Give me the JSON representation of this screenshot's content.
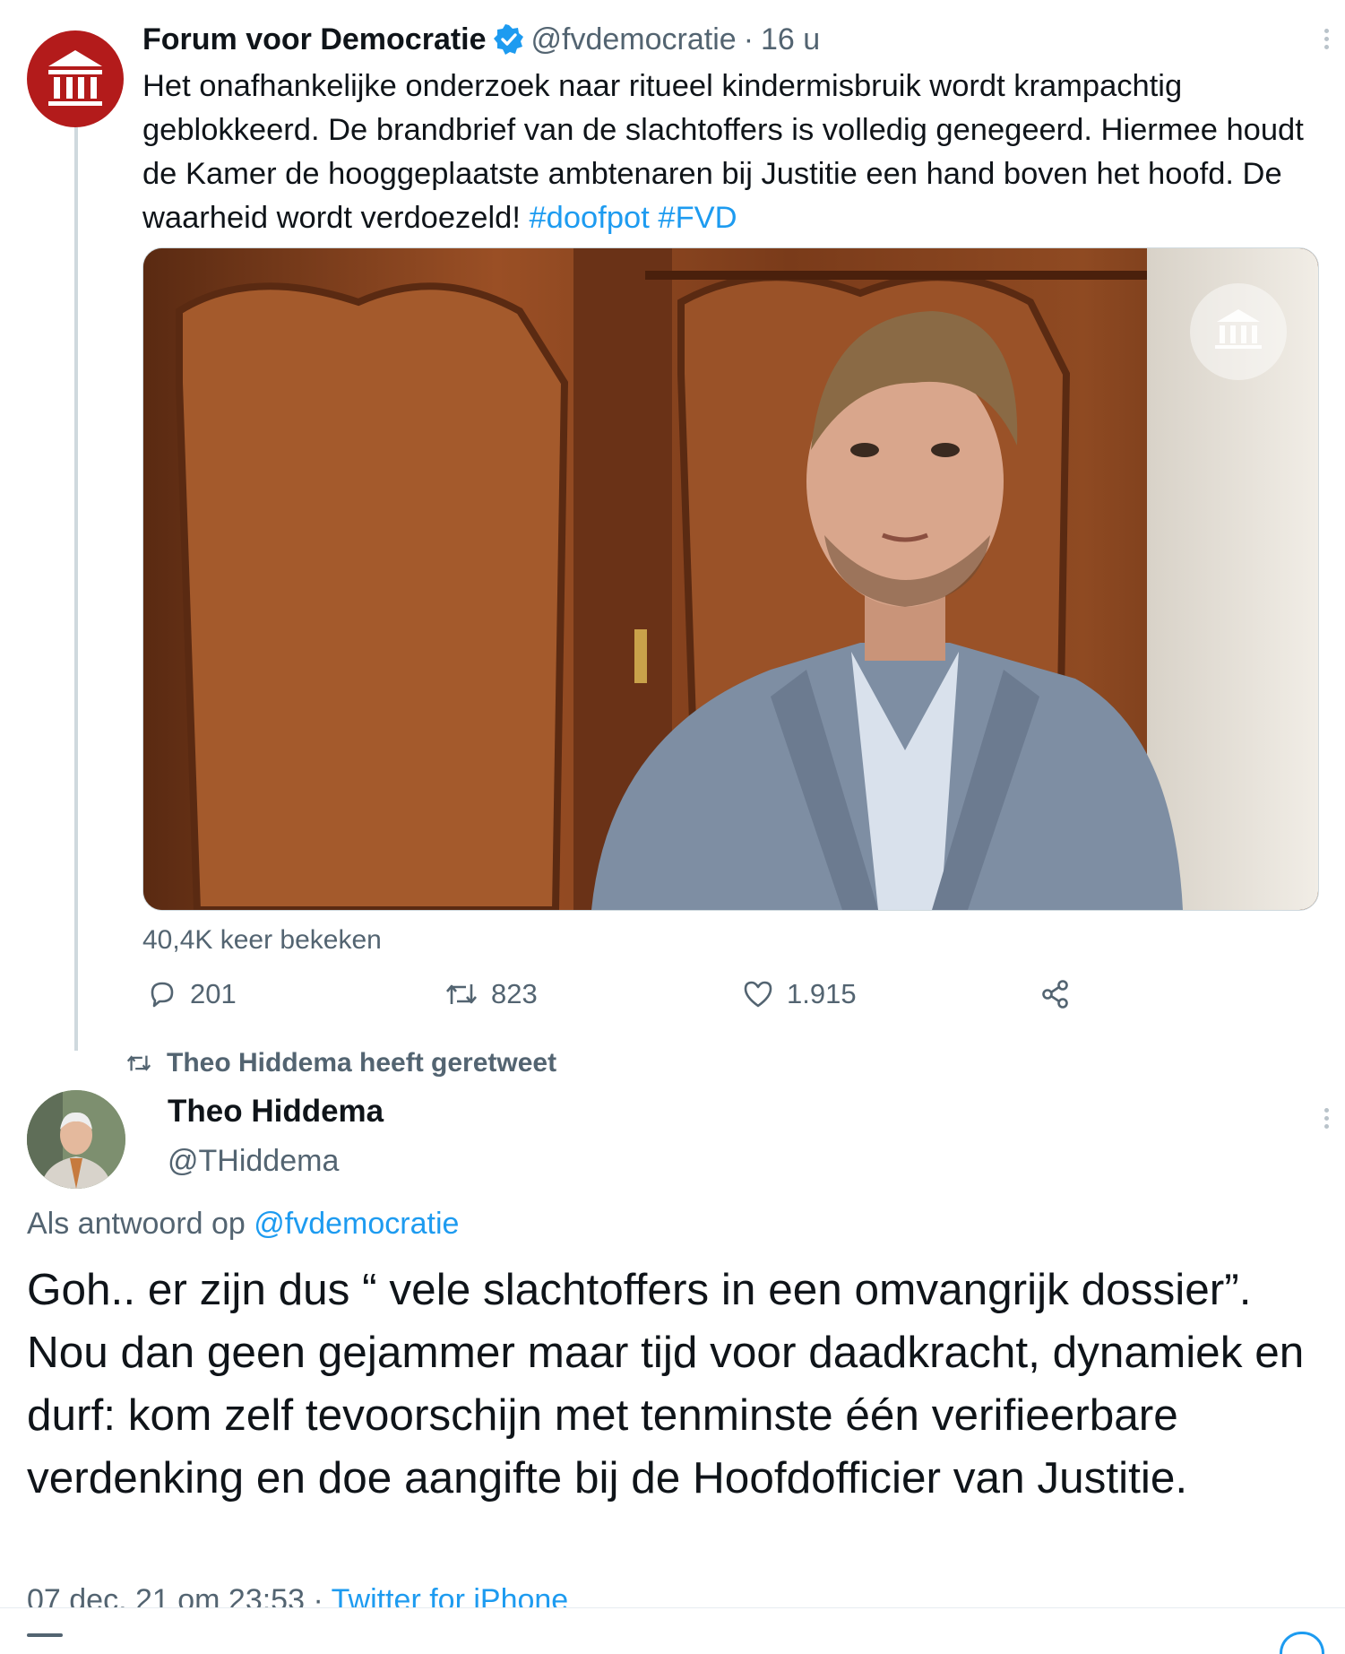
{
  "tweet1": {
    "name": "Forum voor Democratie",
    "handle": "@fvdemocratie",
    "separator": "·",
    "time": "16 u",
    "text": "Het onafhankelijke onderzoek naar ritueel kindermisbruik wordt krampachtig geblokkeerd. De brandbrief van de slachtoffers is volledig genegeerd. Hiermee houdt de Kamer de hooggeplaatste ambtenaren bij Justitie een hand boven het hoofd. De waarheid wordt verdoezeld!",
    "hashtags": [
      "#doofpot",
      "#FVD"
    ],
    "views": "40,4K keer bekeken",
    "replies": "201",
    "retweets": "823",
    "likes": "1.915",
    "icons": {
      "avatar": "pillars-logo-icon",
      "verified": "verified-badge-icon",
      "reply": "reply-icon",
      "retweet": "retweet-icon",
      "like": "heart-icon",
      "share": "share-icon",
      "more": "more-options-icon"
    },
    "colors": {
      "avatar_bg": "#b31b1b",
      "link": "#1d9bf0",
      "verified": "#1d9bf0"
    }
  },
  "retweet_notice": "Theo Hiddema heeft geretweet",
  "tweet2": {
    "name": "Theo Hiddema",
    "handle": "@THiddema",
    "reply_prefix": "Als antwoord op",
    "reply_mention": "@fvdemocratie",
    "text": "Goh.. er zijn dus “ vele slachtoffers in een omvangrijk dossier”. Nou dan geen gejammer maar tijd voor daadkracht, dynamiek en durf: kom zelf tevoorschijn met tenminste één verifieerbare verdenking en doe aangifte bij de Hoofdofficier van Justitie.",
    "date": "07 dec. 21 om 23:53",
    "separator": "·",
    "source": "Twitter for iPhone"
  }
}
